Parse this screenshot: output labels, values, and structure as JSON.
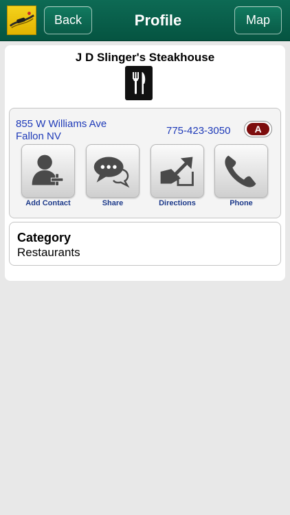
{
  "header": {
    "back_label": "Back",
    "title": "Profile",
    "map_label": "Map"
  },
  "business": {
    "name": "J D Slinger's Steakhouse",
    "category_icon": "fork-knife-icon"
  },
  "contact": {
    "address_line1": "855 W Williams Ave",
    "address_line2": "Fallon NV",
    "phone": "775-423-3050",
    "badge": "A",
    "actions": [
      {
        "label": "Add Contact",
        "icon": "add-contact-icon"
      },
      {
        "label": "Share",
        "icon": "share-icon"
      },
      {
        "label": "Directions",
        "icon": "directions-icon"
      },
      {
        "label": "Phone",
        "icon": "phone-icon"
      }
    ]
  },
  "category": {
    "label": "Category",
    "value": "Restaurants"
  },
  "colors": {
    "header_green": "#0a654f",
    "link_blue": "#1d39b8",
    "badge_red": "#7d0d0d",
    "logo_yellow": "#f2c60f"
  }
}
